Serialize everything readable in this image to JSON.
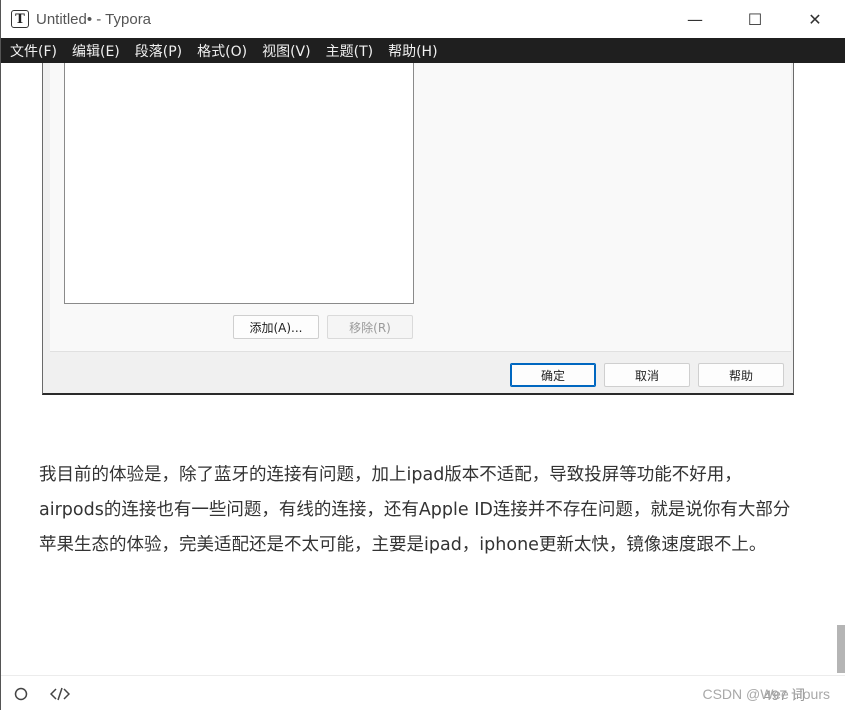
{
  "window": {
    "title": "Untitled• - Typora",
    "app_icon_letter": "T",
    "controls": {
      "minimize": "—",
      "maximize": "☐",
      "close": "✕"
    }
  },
  "menubar": {
    "items": [
      {
        "label": "文件(F)"
      },
      {
        "label": "编辑(E)"
      },
      {
        "label": "段落(P)"
      },
      {
        "label": "格式(O)"
      },
      {
        "label": "视图(V)"
      },
      {
        "label": "主题(T)"
      },
      {
        "label": "帮助(H)"
      }
    ]
  },
  "embedded_dialog": {
    "add_button": "添加(A)...",
    "remove_button": "移除(R)",
    "ok_button": "确定",
    "cancel_button": "取消",
    "help_button": "帮助"
  },
  "document": {
    "paragraph": "我目前的体验是，除了蓝牙的连接有问题，加上ipad版本不适配，导致投屏等功能不好用，airpods的连接也有一些问题，有线的连接，还有Apple ID连接并不存在问题，就是说你有大部分苹果生态的体验，完美适配还是不太可能，主要是ipad，iphone更新太快，镜像速度跟不上。"
  },
  "statusbar": {
    "word_count": "497 词",
    "watermark": "CSDN @Wee Hours",
    "icons": [
      "outline-toggle-icon",
      "source-code-icon"
    ]
  }
}
